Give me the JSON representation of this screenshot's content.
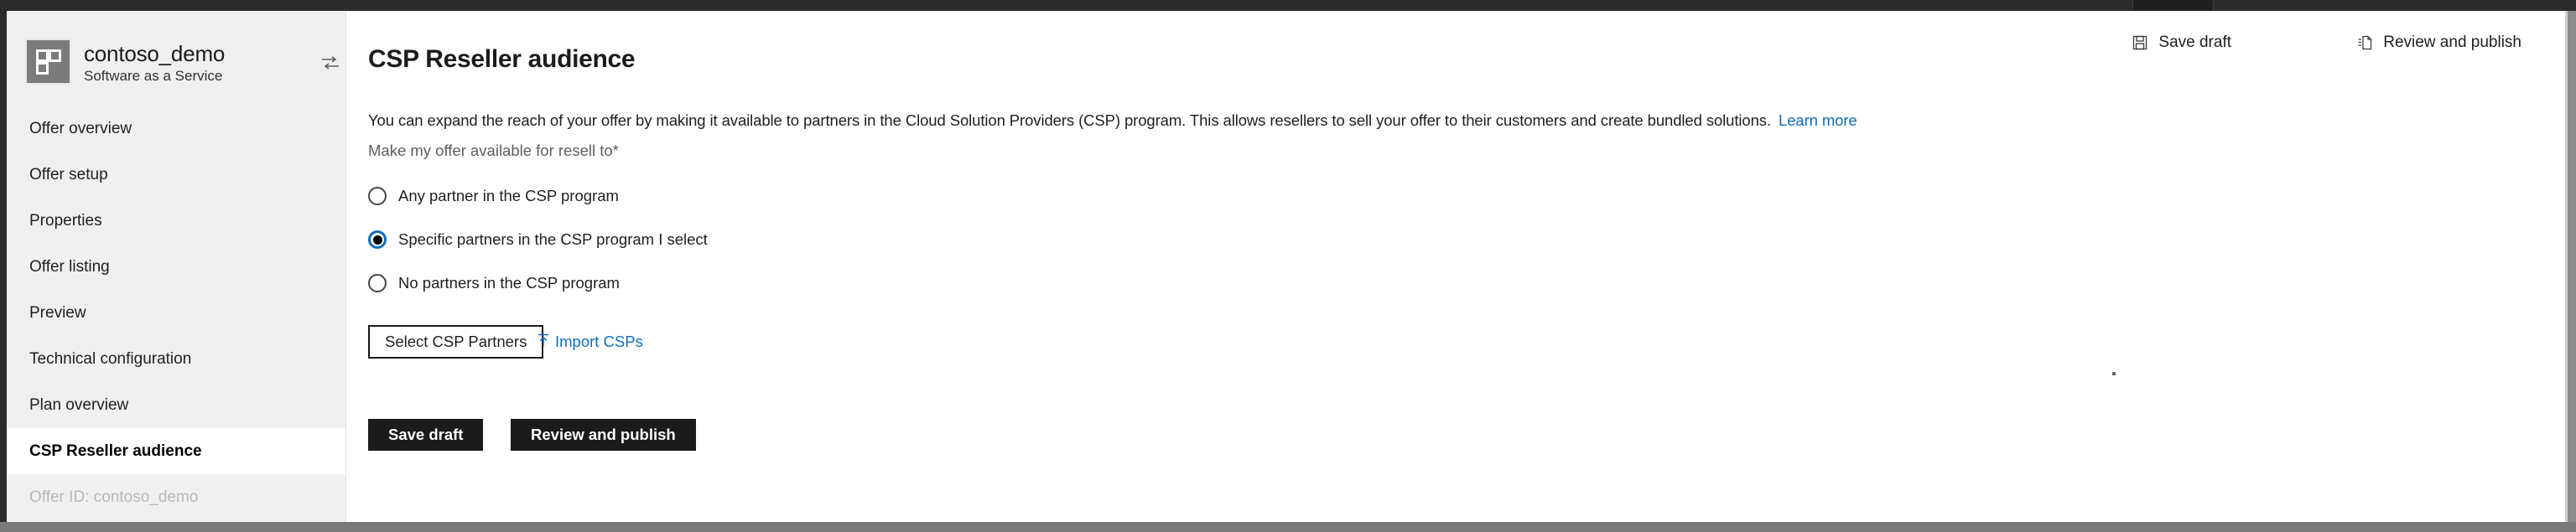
{
  "window": {
    "chrome_bar_color": "#2b2b2b",
    "frame_border_color": "#8c8c8c"
  },
  "sidebar": {
    "offer": {
      "logo_icon": "app-tiles-icon",
      "name": "contoso_demo",
      "type": "Software as a Service",
      "switch_icon": "switch-offer-icon"
    },
    "items": [
      {
        "label": "Offer overview",
        "selected": false
      },
      {
        "label": "Offer setup",
        "selected": false
      },
      {
        "label": "Properties",
        "selected": false
      },
      {
        "label": "Offer listing",
        "selected": false
      },
      {
        "label": "Preview",
        "selected": false
      },
      {
        "label": "Technical configuration",
        "selected": false
      },
      {
        "label": "Plan overview",
        "selected": false
      },
      {
        "label": "CSP Reseller audience",
        "selected": true
      }
    ],
    "offer_id_label": "Offer ID: contoso_demo"
  },
  "header": {
    "title": "CSP Reseller audience",
    "commands": [
      {
        "label": "Save draft",
        "icon": "save-icon"
      },
      {
        "label": "Review and publish",
        "icon": "publish-document-icon"
      }
    ]
  },
  "main": {
    "intro_text": "You can expand the reach of your offer by making it available to partners in the Cloud Solution Providers (CSP) program. This allows resellers to sell your offer to their customers and create bundled solutions.",
    "learn_more_label": "Learn more",
    "field_label": "Make my offer available for resell to*",
    "radio_options": [
      {
        "label": "Any partner in the CSP program",
        "checked": false
      },
      {
        "label": "Specific partners in the CSP program I select",
        "checked": true
      },
      {
        "label": "No partners in the CSP program",
        "checked": false
      }
    ],
    "select_partners_label": "Select CSP Partners",
    "import_csps_label": "Import CSPs",
    "import_csps_icon": "upload-icon",
    "footer_buttons": [
      {
        "label": "Save draft"
      },
      {
        "label": "Review and publish"
      }
    ]
  },
  "colors": {
    "accent_link": "#0f6cbd",
    "radio_selected_ring": "#0f6cbd",
    "primary_button_bg": "#1b1b1b",
    "sidebar_bg": "#f0f0f0"
  }
}
